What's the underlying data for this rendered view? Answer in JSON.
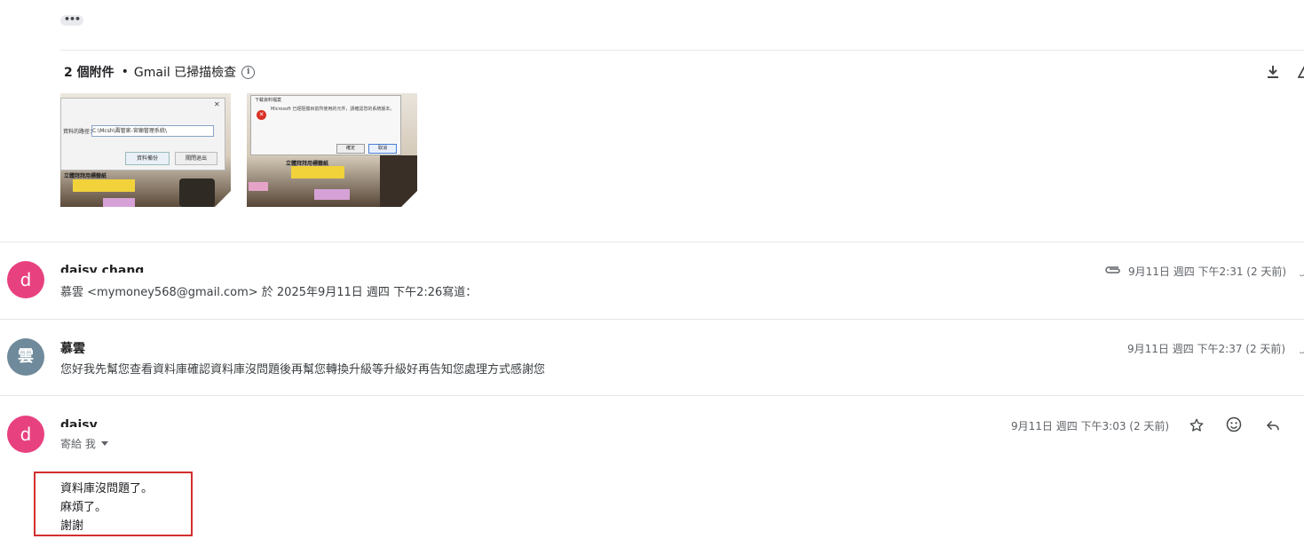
{
  "thread_toolbar": {
    "ellipsis_label": "•••"
  },
  "attachments": {
    "count_label": "2 個附件",
    "separator": "•",
    "scan_label": "Gmail 已掃描檢查",
    "info_glyph": "i",
    "thumb1": {
      "path_label": "資料的路徑：",
      "path_value": "C:\\Mcsh\\壽管家-宮廟管理系統\\",
      "backup_button": "資料備份",
      "exit_button": "關閉退出",
      "banner": "立體拜拜用標籤紙"
    },
    "thumb2": {
      "dialog_title": "下載資料檔案",
      "dialog_text": "Microsoft 已經阻擋目前所使用的元件，請確認您的系統版本。",
      "ok_button": "確定",
      "cancel_button": "取消",
      "banner": "立體拜拜用標籤紙"
    }
  },
  "messages": [
    {
      "avatar_letter": "d",
      "avatar_color": "#e8417f",
      "sender": "daisy chang",
      "quote_line": "慕雲 <mymoney568@gmail.com> 於 2025年9月11日 週四 下午2:26寫道：",
      "date": "9月11日 週四 下午2:31 (2 天前)",
      "has_attachment": true
    },
    {
      "avatar_letter": "雲",
      "avatar_color": "#6f8a9a",
      "sender": "慕雲",
      "snippet": "您好我先幫您查看資料庫確認資料庫沒問題後再幫您轉換升級等升級好再告知您處理方式感謝您",
      "date": "9月11日 週四 下午2:37 (2 天前)"
    },
    {
      "avatar_letter": "d",
      "avatar_color": "#e8417f",
      "sender": "daisy",
      "to_line": "寄給 我",
      "date": "9月11日 週四 下午3:03 (2 天前)",
      "body_lines": [
        "資料庫沒問題了。",
        "麻煩了。",
        "謝謝"
      ]
    }
  ],
  "icons": {
    "download": "download-icon",
    "attachment": "paperclip-icon",
    "star": "star-icon",
    "emoji": "emoji-icon",
    "reply": "reply-icon"
  },
  "colors": {
    "highlight_box": "#d32f2f",
    "pink_avatar": "#e8417f",
    "gray_avatar": "#6f8a9a"
  }
}
